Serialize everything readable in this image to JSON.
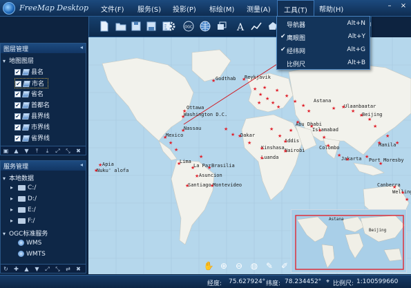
{
  "app": {
    "title": "FreeMap Desktop"
  },
  "menu": [
    {
      "label": "文件(F)"
    },
    {
      "label": "服务(S)"
    },
    {
      "label": "投影(P)"
    },
    {
      "label": "标绘(M)"
    },
    {
      "label": "测量(A)"
    },
    {
      "label": "工具(T)"
    },
    {
      "label": "帮助(H)"
    }
  ],
  "window_buttons": {
    "minimize": "–",
    "close": "×"
  },
  "tools_menu": [
    {
      "label": "导航器",
      "shortcut": "Alt+N",
      "checked": ""
    },
    {
      "label": "鹰眼图",
      "shortcut": "Alt+Y",
      "checked": "✔"
    },
    {
      "label": "经纬网",
      "shortcut": "Alt+G",
      "checked": "✔"
    },
    {
      "label": "比例尺",
      "shortcut": "Alt+B",
      "checked": ""
    }
  ],
  "layer_panel": {
    "title": "图层管理",
    "pin": "◂",
    "root": "地图图层",
    "layers": [
      {
        "label": "县名",
        "checked": "✔"
      },
      {
        "label": "市名",
        "checked": "✔"
      },
      {
        "label": "省名",
        "checked": "✔"
      },
      {
        "label": "首都名",
        "checked": "✔"
      },
      {
        "label": "县界线",
        "checked": "✔"
      },
      {
        "label": "市界线",
        "checked": "✔"
      },
      {
        "label": "省界线",
        "checked": "✔"
      }
    ]
  },
  "service_panel": {
    "title": "服务管理",
    "pin": "◂",
    "local_root": "本地数据",
    "drives": [
      "C:/",
      "D:/",
      "E:/",
      "F:/"
    ],
    "ogc_root": "OGC标准服务",
    "ogc_items": [
      "WMS",
      "WMTS"
    ]
  },
  "map_labels": [
    "Godthab",
    "Ottawa",
    "Washington D.C.",
    "Nassau",
    "Mexico",
    "Apia",
    "Nuku' alofa",
    "Lima",
    "La Paz",
    "Brasilia",
    "Asuncion",
    "Santiago",
    "Montevideo",
    "Reykjavik",
    "Ulaanbaatar",
    "Beijing",
    "Islamabad",
    "Colombo",
    "Jakarta",
    "Astana",
    "Canberra",
    "Wellington",
    "Port Moresby",
    "Abu Dhabi",
    "Addis",
    "Nairobi",
    "Luanda",
    "Kinshasa",
    "Dakar",
    "Manila"
  ],
  "status": {
    "lon_label": "经度:",
    "lon_value": "75.627924°",
    "lat_label": "纬度:",
    "lat_value": "78.234452°",
    "scale_label": "比例尺:",
    "scale_value": "1:100599660"
  },
  "colors": {
    "accent": "#2c5f95",
    "marker": "#e0202a",
    "panel_bg": "#0e2747"
  }
}
